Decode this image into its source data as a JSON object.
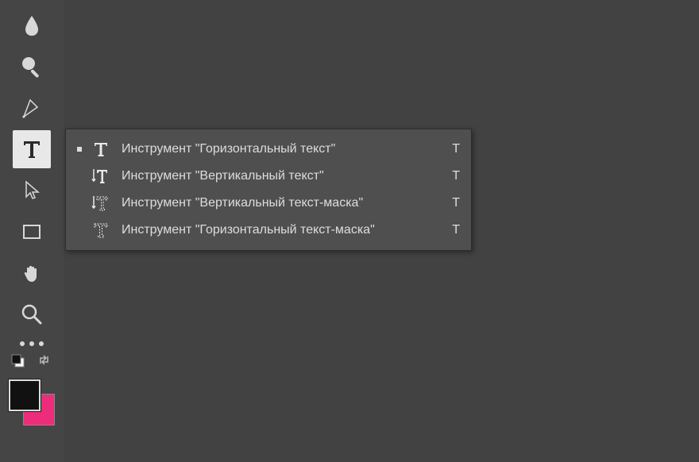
{
  "toolbar": {
    "tools": [
      {
        "name": "blur-tool"
      },
      {
        "name": "dodge-tool"
      },
      {
        "name": "pen-tool"
      },
      {
        "name": "type-tool",
        "active": true
      },
      {
        "name": "path-selection-tool"
      },
      {
        "name": "rectangle-tool"
      },
      {
        "name": "hand-tool"
      },
      {
        "name": "zoom-tool"
      }
    ],
    "colors": {
      "foreground": "#111111",
      "background": "#ed2d7a"
    }
  },
  "flyout": {
    "items": [
      {
        "label": "Инструмент \"Горизонтальный текст\"",
        "shortcut": "T",
        "selected": true,
        "icon": "horizontal-type"
      },
      {
        "label": "Инструмент \"Вертикальный текст\"",
        "shortcut": "T",
        "selected": false,
        "icon": "vertical-type"
      },
      {
        "label": "Инструмент \"Вертикальный текст-маска\"",
        "shortcut": "T",
        "selected": false,
        "icon": "vertical-type-mask"
      },
      {
        "label": "Инструмент \"Горизонтальный текст-маска\"",
        "shortcut": "T",
        "selected": false,
        "icon": "horizontal-type-mask"
      }
    ]
  }
}
